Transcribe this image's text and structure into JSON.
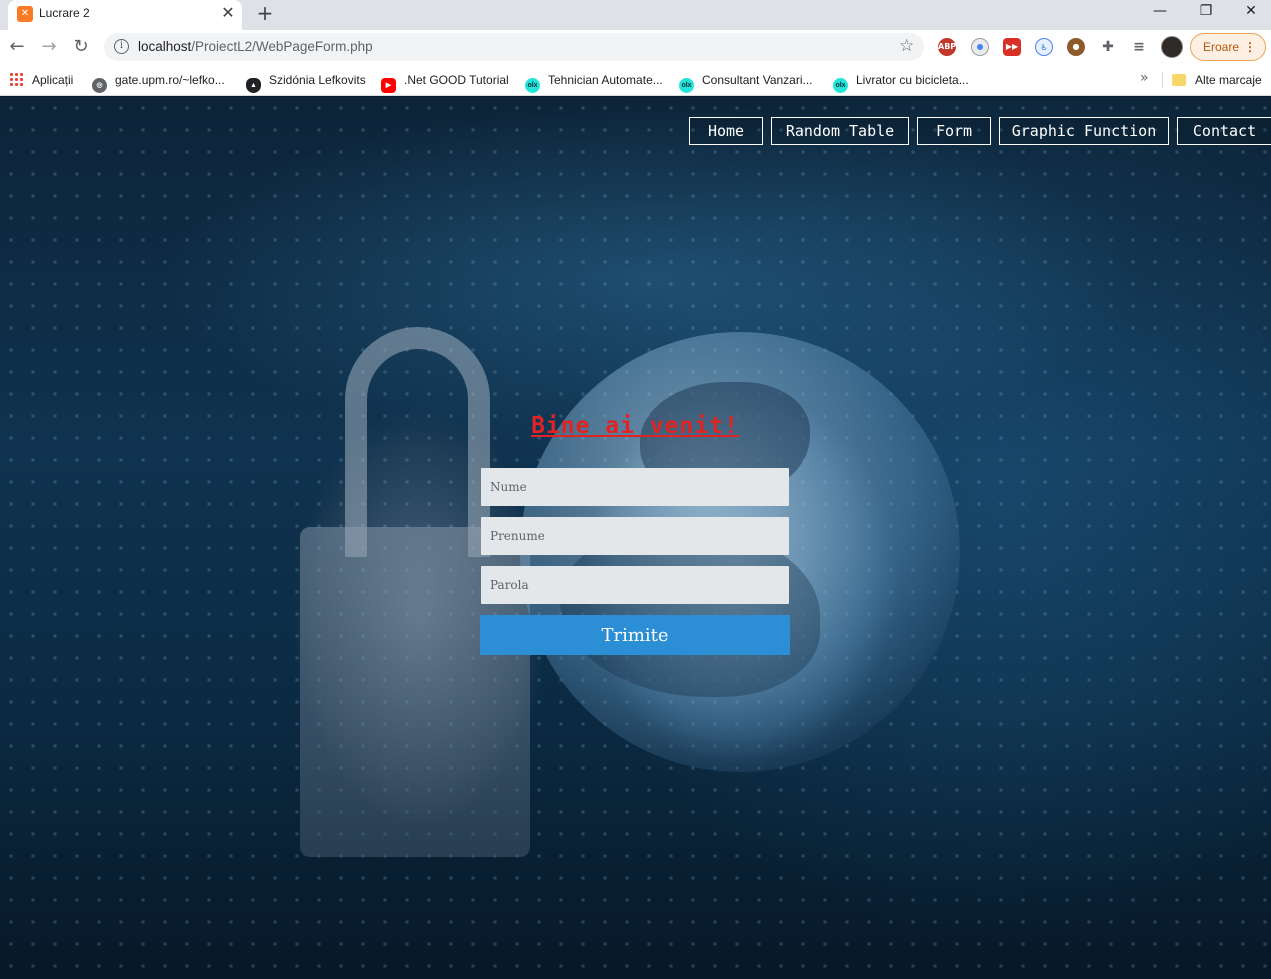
{
  "browser": {
    "tab_title": "Lucrare 2",
    "url_host": "localhost",
    "url_path": "/ProiectL2/WebPageForm.php",
    "error_label": "Eroare"
  },
  "bookmarks": [
    {
      "label": "Aplicații",
      "icon": "apps-grid-icon"
    },
    {
      "label": "gate.upm.ro/~lefko...",
      "icon": "globe-icon"
    },
    {
      "label": "Szidónia Lefkovits",
      "icon": "tux-icon"
    },
    {
      "label": ".Net GOOD Tutorial",
      "icon": "youtube-icon"
    },
    {
      "label": "Tehnician Automate...",
      "icon": "olx-icon"
    },
    {
      "label": "Consultant Vanzari...",
      "icon": "olx-icon"
    },
    {
      "label": "Livrator cu bicicleta...",
      "icon": "olx-icon"
    }
  ],
  "other_bookmarks": "Alte marcaje",
  "nav": {
    "items": [
      "Home",
      "Random Table",
      "Form",
      "Graphic Function",
      "Contact"
    ]
  },
  "form": {
    "heading": "Bine ai venit!",
    "nume_placeholder": "Nume",
    "prenume_placeholder": "Prenume",
    "parola_placeholder": "Parola",
    "submit_label": "Trimite"
  },
  "colors": {
    "heading": "#e02323",
    "submit": "#2c8fd6",
    "nav_border": "#ffffff"
  }
}
